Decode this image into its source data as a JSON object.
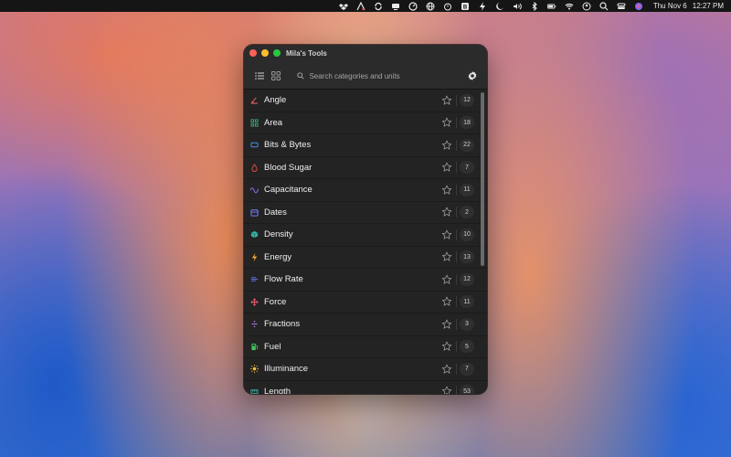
{
  "menubar": {
    "icons": [
      "dropbox-icon",
      "a-icon",
      "cloud-sync-icon",
      "cast-icon",
      "gauge-icon",
      "globe-icon",
      "timer-icon",
      "b-icon",
      "bolt-icon",
      "moon-icon",
      "volume-icon",
      "bluetooth-icon",
      "battery-icon",
      "wifi-icon",
      "user-icon",
      "search-icon",
      "control-center-icon",
      "siri-icon"
    ],
    "date": "Thu Nov 6",
    "time": "12:27 PM"
  },
  "window": {
    "title": "Mila's Tools",
    "search_placeholder": "Search categories and units"
  },
  "rows": [
    {
      "label": "Angle",
      "count": "12",
      "icon": "angle-icon",
      "color": "#e05a5a"
    },
    {
      "label": "Area",
      "count": "18",
      "icon": "area-icon",
      "color": "#3fae7a"
    },
    {
      "label": "Bits & Bytes",
      "count": "22",
      "icon": "bits-icon",
      "color": "#4a8df0"
    },
    {
      "label": "Blood Sugar",
      "count": "7",
      "icon": "drop-icon",
      "color": "#e04848"
    },
    {
      "label": "Capacitance",
      "count": "11",
      "icon": "wave-icon",
      "color": "#8a6ef0"
    },
    {
      "label": "Dates",
      "count": "2",
      "icon": "calendar-icon",
      "color": "#7b7ef5"
    },
    {
      "label": "Density",
      "count": "10",
      "icon": "cube-icon",
      "color": "#3bb3a6"
    },
    {
      "label": "Energy",
      "count": "13",
      "icon": "bolt-icon",
      "color": "#f2a93b"
    },
    {
      "label": "Flow Rate",
      "count": "12",
      "icon": "flow-icon",
      "color": "#5a6ee0"
    },
    {
      "label": "Force",
      "count": "11",
      "icon": "force-icon",
      "color": "#e05a6a"
    },
    {
      "label": "Fractions",
      "count": "3",
      "icon": "fraction-icon",
      "color": "#b07ad8"
    },
    {
      "label": "Fuel",
      "count": "5",
      "icon": "fuel-icon",
      "color": "#3fbf5a"
    },
    {
      "label": "Illuminance",
      "count": "7",
      "icon": "sun-icon",
      "color": "#f2c23b"
    },
    {
      "label": "Length",
      "count": "53",
      "icon": "ruler-icon",
      "color": "#3bb3a6"
    }
  ]
}
